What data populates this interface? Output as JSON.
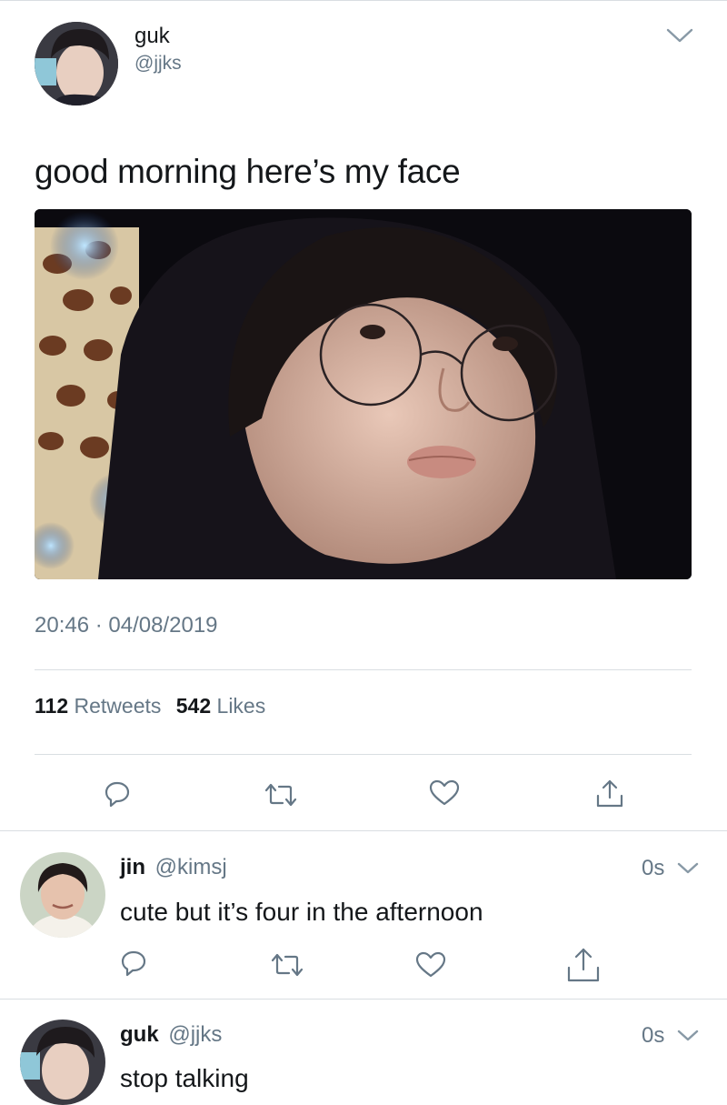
{
  "tweet": {
    "display_name": "guk",
    "handle": "@jjks",
    "text": "good morning here’s my face",
    "time": "20:46",
    "separator": "·",
    "date": "04/08/2019",
    "retweets_count": "112",
    "retweets_label": "Retweets",
    "likes_count": "542",
    "likes_label": "Likes",
    "icons": [
      "reply-icon",
      "retweet-icon",
      "like-icon",
      "share-icon",
      "chevron-down-icon"
    ]
  },
  "replies": [
    {
      "display_name": "jin",
      "handle": "@kimsj",
      "time": "0s",
      "text": "cute but it’s four in the afternoon"
    },
    {
      "display_name": "guk",
      "handle": "@jjks",
      "time": "0s",
      "text": "stop talking"
    }
  ],
  "colors": {
    "text": "#14171a",
    "muted": "#657786",
    "divider": "#d9dee2",
    "photo_bg": "#0b0a0f"
  }
}
